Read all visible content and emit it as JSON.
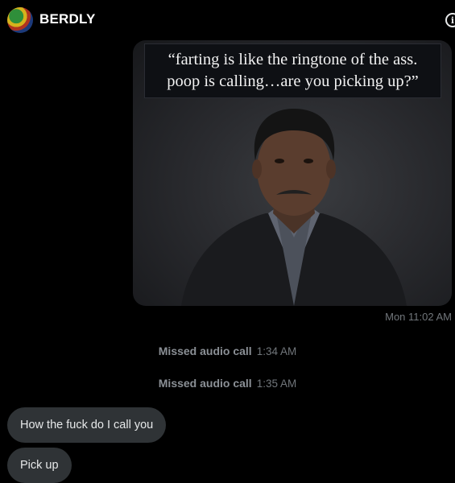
{
  "header": {
    "title": "BERDLY",
    "avatar_icon": "avatar-image",
    "info_icon": "info-icon",
    "info_glyph": "i"
  },
  "media_message": {
    "quote": "“farting is like the ringtone of the ass.\npoop is calling…are you picking up?”",
    "timestamp": "Mon 11:02 AM"
  },
  "system_events": [
    {
      "label": "Missed audio call",
      "time": "1:34 AM"
    },
    {
      "label": "Missed audio call",
      "time": "1:35 AM"
    }
  ],
  "incoming_messages": [
    {
      "text": "How the fuck do I call you"
    },
    {
      "text": "Pick up"
    }
  ],
  "colors": {
    "background": "#000000",
    "bubble": "#2f3336",
    "muted_text": "#71767b"
  }
}
